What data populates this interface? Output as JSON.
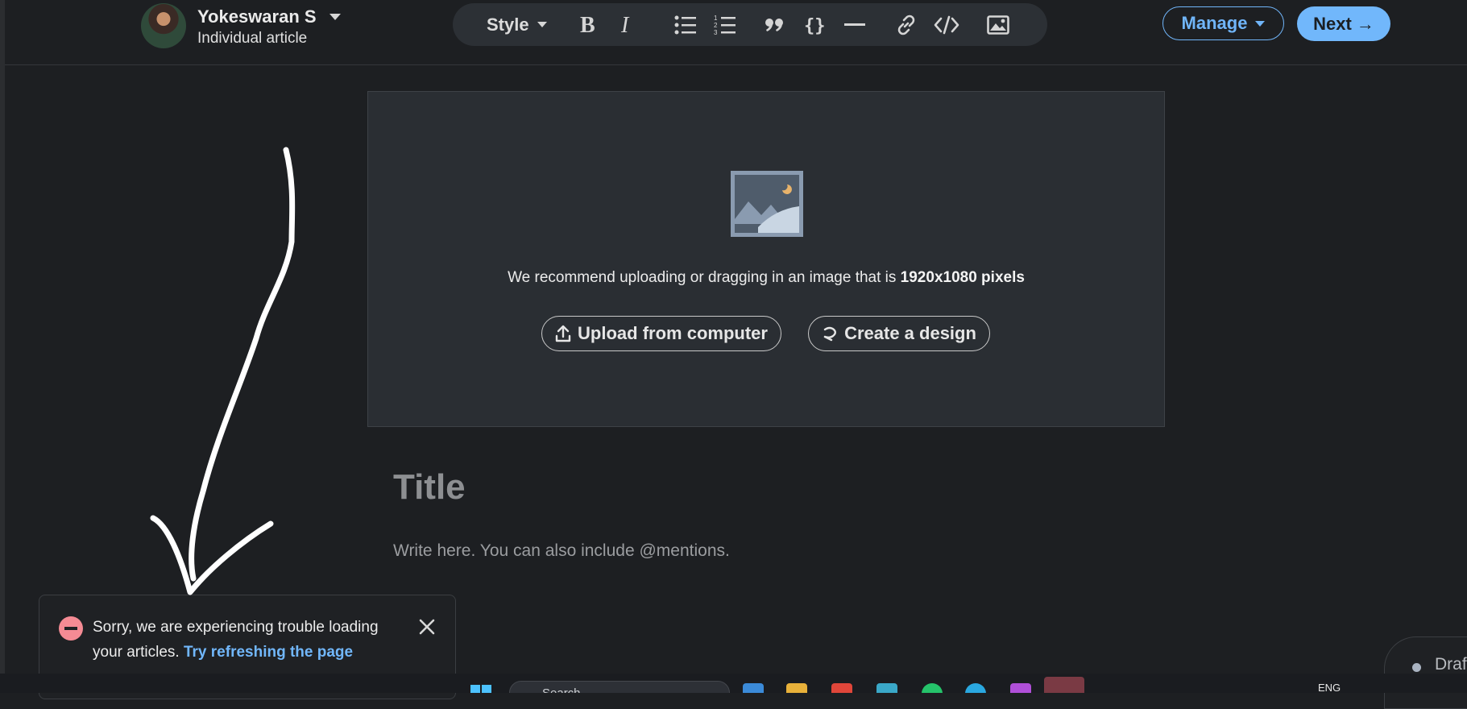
{
  "header": {
    "author_name": "Yokeswaran S",
    "author_subtitle": "Individual article",
    "manage_label": "Manage",
    "next_label": "Next →"
  },
  "toolbar": {
    "style_label": "Style",
    "icons": [
      "bold-icon",
      "italic-icon",
      "bulleted-list-icon",
      "numbered-list-icon",
      "quote-icon",
      "code-block-icon",
      "divider-icon",
      "link-icon",
      "embed-code-icon",
      "image-icon"
    ]
  },
  "cover": {
    "recommend_text": "We recommend uploading or dragging in an image that is ",
    "recommend_size": "1920x1080 pixels",
    "upload_label": "Upload from computer",
    "design_label": "Create a design"
  },
  "editor": {
    "title_placeholder": "Title",
    "body_placeholder": "Write here. You can also include @mentions."
  },
  "toast": {
    "message": "Sorry, we are experiencing trouble loading your articles.",
    "link_label": "Try refreshing the page"
  },
  "drafts": {
    "label": "Drafts"
  },
  "taskbar": {
    "search_placeholder": "Search",
    "language": "ENG"
  },
  "colors": {
    "accent": "#71b7fb",
    "background": "#1d1f22",
    "error": "#f58b94"
  }
}
